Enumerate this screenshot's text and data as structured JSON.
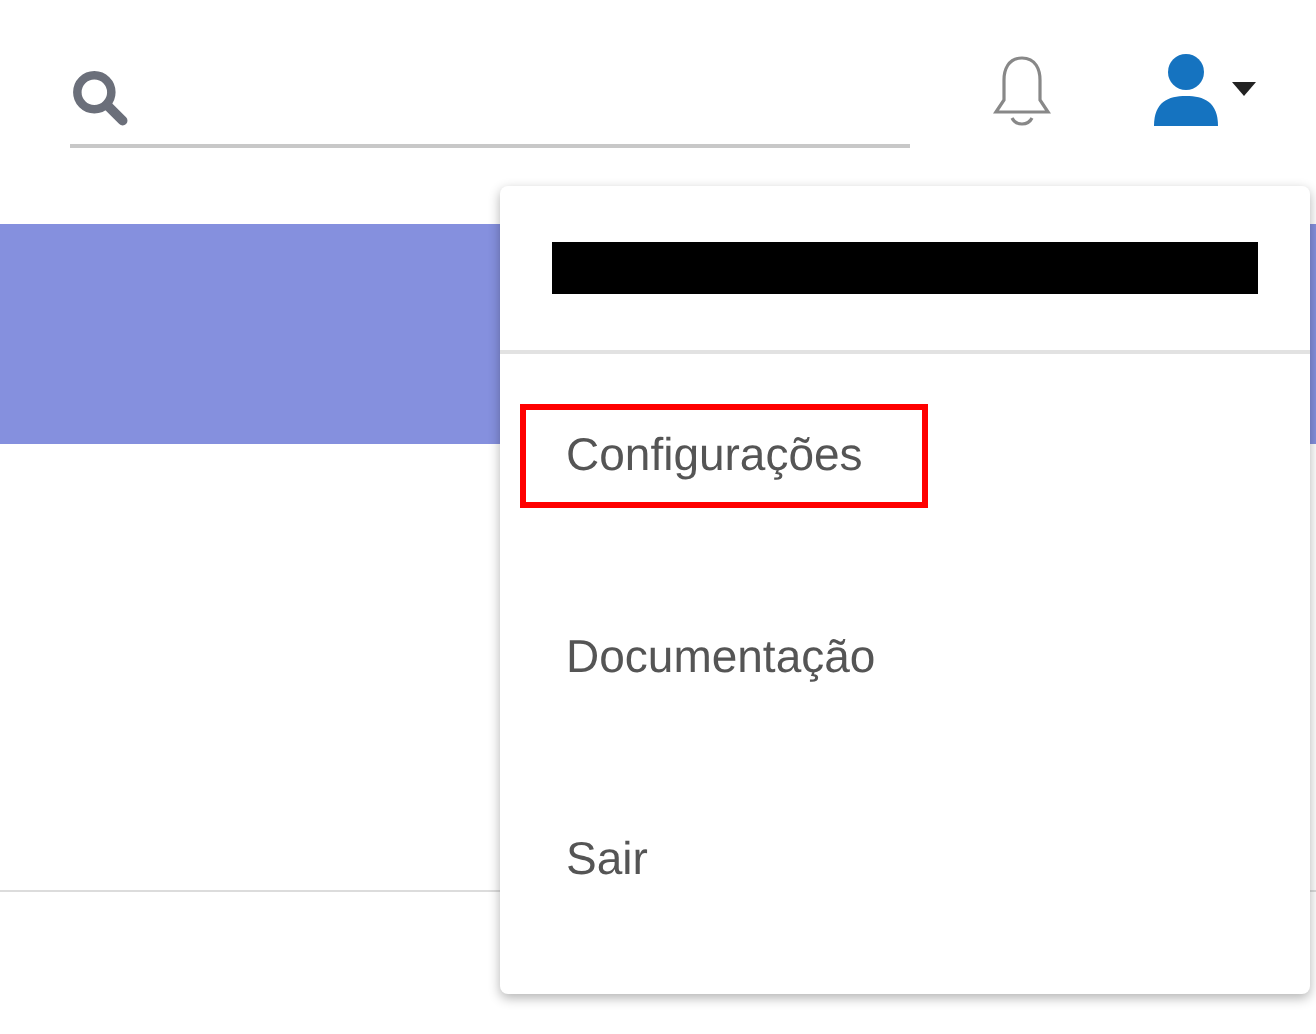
{
  "user_menu": {
    "items": [
      {
        "label": "Configurações",
        "highlighted": true
      },
      {
        "label": "Documentação",
        "highlighted": false
      },
      {
        "label": "Sair",
        "highlighted": false
      }
    ]
  }
}
